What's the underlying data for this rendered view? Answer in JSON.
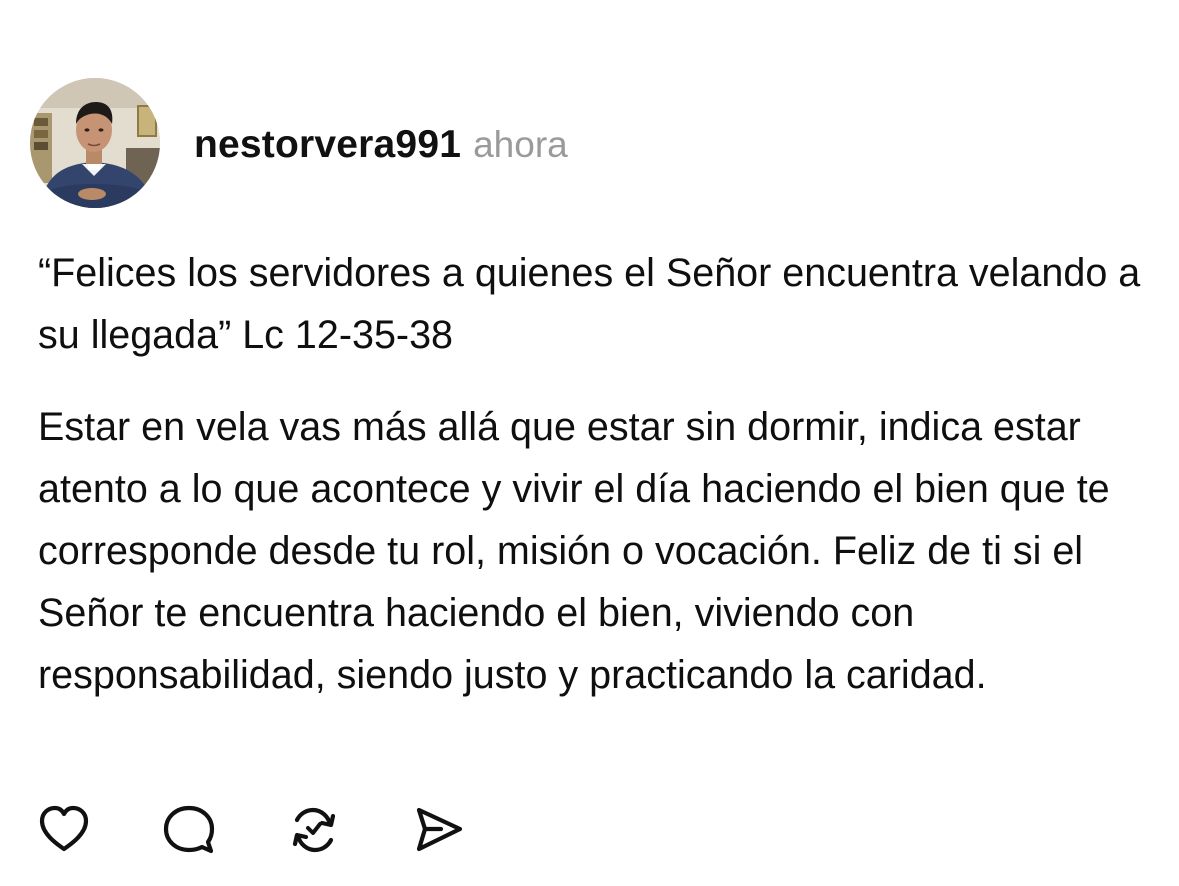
{
  "post": {
    "author": {
      "username": "nestorvera991",
      "avatar": "profile-photo"
    },
    "timestamp": "ahora",
    "paragraphs": [
      "“Felices los servidores a quienes el Señor encuentra velando a su llegada” Lc 12-35-38",
      "Estar en vela vas más allá que estar sin dormir, indica estar atento a lo que acontece y vivir el día haciendo el bien que te corresponde desde tu rol, misión o vocación. Feliz de ti si el Señor te encuentra haciendo el bien, viviendo con responsabilidad, siendo justo y practicando la caridad."
    ],
    "actions": [
      {
        "icon": "heart-icon"
      },
      {
        "icon": "comment-icon"
      },
      {
        "icon": "repost-icon"
      },
      {
        "icon": "share-icon"
      }
    ]
  },
  "colors": {
    "text": "#0f0f0f",
    "timestamp": "#9a9a9a",
    "icon": "#111111",
    "background": "#ffffff"
  }
}
